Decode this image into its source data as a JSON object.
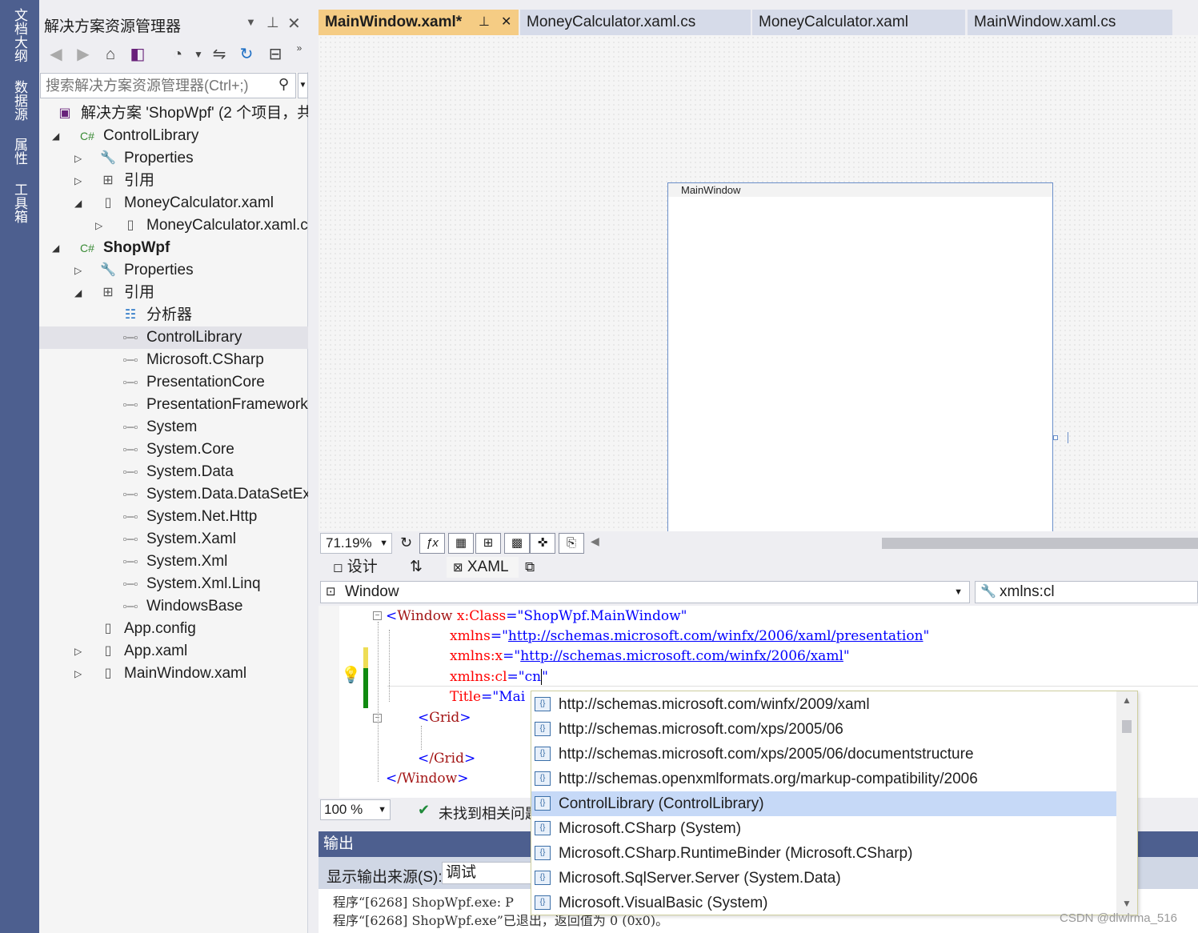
{
  "dock": {
    "tabs": [
      "文档大纲",
      "数据源",
      "属性",
      "工具箱"
    ]
  },
  "solution_explorer": {
    "title": "解决方案资源管理器",
    "search_placeholder": "搜索解决方案资源管理器(Ctrl+;)",
    "tree": [
      {
        "label": "解决方案 'ShopWpf' (2 个项目，共",
        "icon": "solution-icon"
      },
      {
        "label": "ControlLibrary",
        "icon": "csharp-project-icon"
      },
      {
        "label": "Properties",
        "icon": "wrench-icon"
      },
      {
        "label": "引用",
        "icon": "references-icon"
      },
      {
        "label": "MoneyCalculator.xaml",
        "icon": "xaml-file-icon"
      },
      {
        "label": "MoneyCalculator.xaml.cs",
        "icon": "cs-file-icon"
      },
      {
        "label": "ShopWpf",
        "icon": "csharp-project-icon"
      },
      {
        "label": "Properties",
        "icon": "wrench-icon"
      },
      {
        "label": "引用",
        "icon": "references-icon"
      },
      {
        "label": "分析器",
        "icon": "analyzer-icon"
      },
      {
        "label": "ControlLibrary",
        "icon": "reference-icon"
      },
      {
        "label": "Microsoft.CSharp",
        "icon": "reference-icon"
      },
      {
        "label": "PresentationCore",
        "icon": "reference-icon"
      },
      {
        "label": "PresentationFramework",
        "icon": "reference-icon"
      },
      {
        "label": "System",
        "icon": "reference-icon"
      },
      {
        "label": "System.Core",
        "icon": "reference-icon"
      },
      {
        "label": "System.Data",
        "icon": "reference-icon"
      },
      {
        "label": "System.Data.DataSetExt",
        "icon": "reference-icon"
      },
      {
        "label": "System.Net.Http",
        "icon": "reference-icon"
      },
      {
        "label": "System.Xaml",
        "icon": "reference-icon"
      },
      {
        "label": "System.Xml",
        "icon": "reference-icon"
      },
      {
        "label": "System.Xml.Linq",
        "icon": "reference-icon"
      },
      {
        "label": "WindowsBase",
        "icon": "reference-icon"
      },
      {
        "label": "App.config",
        "icon": "config-file-icon"
      },
      {
        "label": "App.xaml",
        "icon": "xaml-file-icon"
      },
      {
        "label": "MainWindow.xaml",
        "icon": "xaml-file-icon"
      }
    ]
  },
  "tabs": [
    {
      "label": "MainWindow.xaml*"
    },
    {
      "label": "MoneyCalculator.xaml.cs"
    },
    {
      "label": "MoneyCalculator.xaml"
    },
    {
      "label": "MainWindow.xaml.cs"
    }
  ],
  "designer": {
    "window_caption": "MainWindow",
    "zoom": "71.19%"
  },
  "split": {
    "design_label": "设计",
    "xaml_label": "XAML"
  },
  "selectors": {
    "element": "Window",
    "member": "xmlns:cl"
  },
  "code": {
    "line1_tag": "Window",
    "line1_attr": "x:Class",
    "line1_val": "ShopWpf.MainWindow",
    "line2_attr": "xmlns",
    "line2_val": "http://schemas.microsoft.com/winfx/2006/xaml/presentation",
    "line3_attr": "xmlns:x",
    "line3_val": "http://schemas.microsoft.com/winfx/2006/xaml",
    "line4_attr": "xmlns:cl",
    "line4_val": "cn",
    "line5_attr": "Title",
    "line5_val": "Mai",
    "line6_tag": "Grid",
    "line7_tag": "/Grid",
    "line8_tag": "/Window"
  },
  "editor_status": {
    "zoom": "100 %",
    "issues": "未找到相关问题"
  },
  "output": {
    "title": "输出",
    "source_label": "显示输出来源(S):",
    "source_value": "调试",
    "line1": "程序“[6268] ShopWpf.exe: P",
    "line2": "程序“[6268] ShopWpf.exe”已退出，返回值为 0 (0x0)。"
  },
  "intellisense": {
    "items": [
      "http://schemas.microsoft.com/winfx/2009/xaml",
      "http://schemas.microsoft.com/xps/2005/06",
      "http://schemas.microsoft.com/xps/2005/06/documentstructure",
      "http://schemas.openxmlformats.org/markup-compatibility/2006",
      "ControlLibrary (ControlLibrary)",
      "Microsoft.CSharp (System)",
      "Microsoft.CSharp.RuntimeBinder (Microsoft.CSharp)",
      "Microsoft.SqlServer.Server (System.Data)",
      "Microsoft.VisualBasic (System)"
    ],
    "selected_index": 4
  },
  "watermark": "CSDN @dlwlrma_516",
  "colors": {
    "dock": "#4d5f8f",
    "active_tab": "#f5cc84",
    "selection": "#c6d9f7"
  }
}
